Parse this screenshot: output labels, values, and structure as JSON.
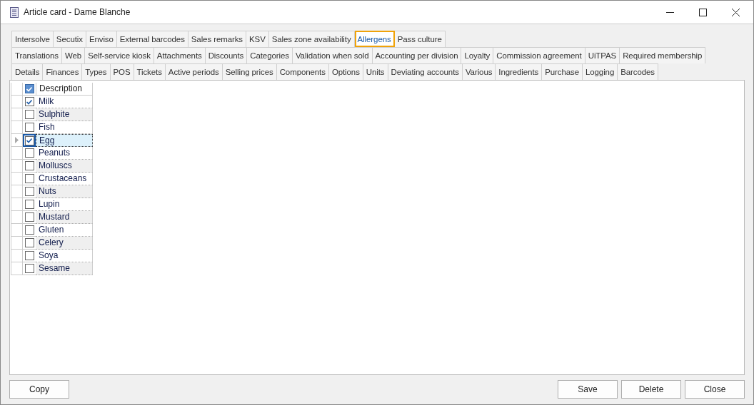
{
  "window": {
    "title": "Article card - Dame Blanche"
  },
  "tab_rows": [
    [
      {
        "label": "Intersolve",
        "selected": false
      },
      {
        "label": "Secutix",
        "selected": false
      },
      {
        "label": "Enviso",
        "selected": false
      },
      {
        "label": "External barcodes",
        "selected": false
      },
      {
        "label": "Sales remarks",
        "selected": false
      },
      {
        "label": "KSV",
        "selected": false
      },
      {
        "label": "Sales zone availability",
        "selected": false
      },
      {
        "label": "Allergens",
        "selected": true
      },
      {
        "label": "Pass culture",
        "selected": false
      }
    ],
    [
      {
        "label": "Translations",
        "selected": false
      },
      {
        "label": "Web",
        "selected": false
      },
      {
        "label": "Self-service kiosk",
        "selected": false
      },
      {
        "label": "Attachments",
        "selected": false
      },
      {
        "label": "Discounts",
        "selected": false
      },
      {
        "label": "Categories",
        "selected": false
      },
      {
        "label": "Validation when sold",
        "selected": false
      },
      {
        "label": "Accounting per division",
        "selected": false
      },
      {
        "label": "Loyalty",
        "selected": false
      },
      {
        "label": "Commission agreement",
        "selected": false
      },
      {
        "label": "UiTPAS",
        "selected": false
      },
      {
        "label": "Required membership",
        "selected": false
      }
    ],
    [
      {
        "label": "Details",
        "selected": false
      },
      {
        "label": "Finances",
        "selected": false
      },
      {
        "label": "Types",
        "selected": false
      },
      {
        "label": "POS",
        "selected": false
      },
      {
        "label": "Tickets",
        "selected": false
      },
      {
        "label": "Active periods",
        "selected": false
      },
      {
        "label": "Selling prices",
        "selected": false
      },
      {
        "label": "Components",
        "selected": false
      },
      {
        "label": "Options",
        "selected": false
      },
      {
        "label": "Units",
        "selected": false
      },
      {
        "label": "Deviating accounts",
        "selected": false
      },
      {
        "label": "Various",
        "selected": false
      },
      {
        "label": "Ingredients",
        "selected": false
      },
      {
        "label": "Purchase",
        "selected": false
      },
      {
        "label": "Logging",
        "selected": false
      },
      {
        "label": "Barcodes",
        "selected": false
      }
    ]
  ],
  "grid": {
    "header": {
      "label": "Description",
      "checked": true
    },
    "rows": [
      {
        "name": "Milk",
        "checked": true,
        "selected": false
      },
      {
        "name": "Sulphite",
        "checked": false,
        "selected": false
      },
      {
        "name": "Fish",
        "checked": false,
        "selected": false
      },
      {
        "name": "Egg",
        "checked": true,
        "selected": true
      },
      {
        "name": "Peanuts",
        "checked": false,
        "selected": false
      },
      {
        "name": "Molluscs",
        "checked": false,
        "selected": false
      },
      {
        "name": "Crustaceans",
        "checked": false,
        "selected": false
      },
      {
        "name": "Nuts",
        "checked": false,
        "selected": false
      },
      {
        "name": "Lupin",
        "checked": false,
        "selected": false
      },
      {
        "name": "Mustard",
        "checked": false,
        "selected": false
      },
      {
        "name": "Gluten",
        "checked": false,
        "selected": false
      },
      {
        "name": "Celery",
        "checked": false,
        "selected": false
      },
      {
        "name": "Soya",
        "checked": false,
        "selected": false
      },
      {
        "name": "Sesame",
        "checked": false,
        "selected": false
      }
    ]
  },
  "buttons_left": [
    "Copy"
  ],
  "buttons_right": [
    "Save",
    "Delete",
    "Close"
  ]
}
